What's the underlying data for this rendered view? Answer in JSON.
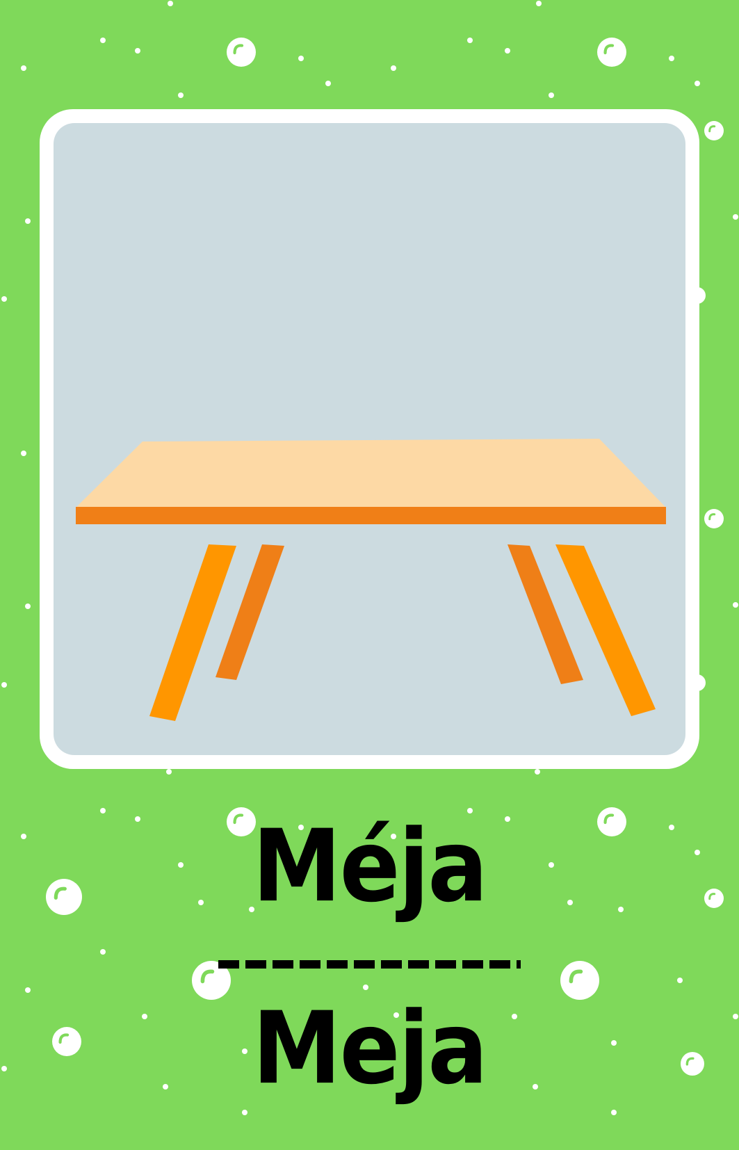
{
  "card": {
    "word_primary": "Méja",
    "word_secondary": "Meja",
    "image_subject": "table",
    "icon": "table-icon"
  },
  "colors": {
    "background": "#7fd95a",
    "bubble": "#ffffff",
    "bubble_shine": "#7fd95a",
    "frame": "#ffffff",
    "photo_background": "#ccdbe0",
    "tabletop": "#fdd9a5",
    "table_edge": "#f07f17",
    "leg_front": "#ff9600",
    "leg_back": "#ef7f17",
    "text": "#000000"
  }
}
